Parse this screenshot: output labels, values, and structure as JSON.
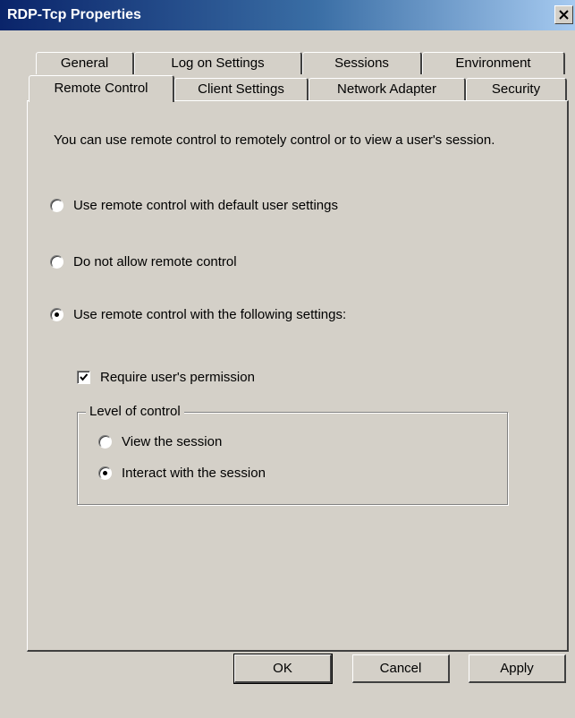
{
  "window": {
    "title": "RDP-Tcp Properties"
  },
  "tabs_back": [
    {
      "label": "General"
    },
    {
      "label": "Log on Settings"
    },
    {
      "label": "Sessions"
    },
    {
      "label": "Environment"
    }
  ],
  "tabs_front": [
    {
      "label": "Remote Control",
      "selected": true
    },
    {
      "label": "Client Settings"
    },
    {
      "label": "Network Adapter"
    },
    {
      "label": "Security"
    }
  ],
  "panel": {
    "intro": "You can use remote control to remotely control or to view a user's session.",
    "options": [
      {
        "label": "Use remote control with default user settings",
        "checked": false
      },
      {
        "label": "Do not allow remote control",
        "checked": false
      },
      {
        "label": "Use remote control with the following settings:",
        "checked": true
      }
    ],
    "require_permission": {
      "label": "Require user's permission",
      "checked": true
    },
    "level_of_control": {
      "label": "Level of control",
      "options": [
        {
          "label": "View the session",
          "checked": false
        },
        {
          "label": "Interact with the session",
          "checked": true
        }
      ]
    }
  },
  "buttons": {
    "ok": "OK",
    "cancel": "Cancel",
    "apply": "Apply"
  },
  "icons": {
    "close": "close-icon",
    "check": "checkmark-icon"
  }
}
